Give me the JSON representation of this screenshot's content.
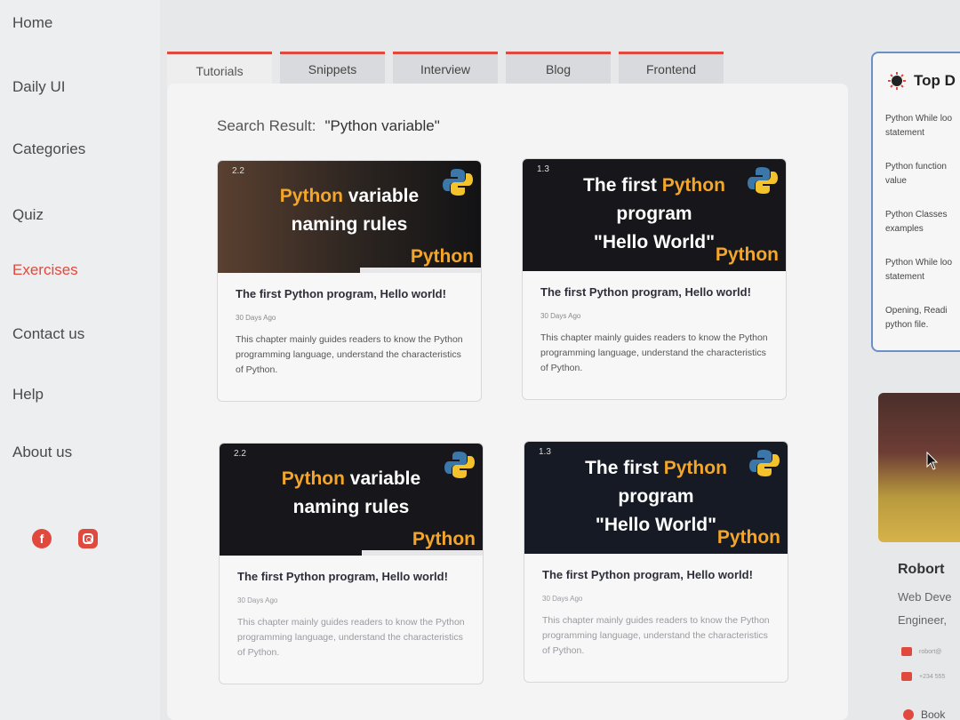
{
  "sidebar": {
    "items": [
      {
        "label": "Home"
      },
      {
        "label": "Daily UI"
      },
      {
        "label": "Categories"
      },
      {
        "label": "Quiz"
      },
      {
        "label": "Exercises"
      },
      {
        "label": "Contact us"
      },
      {
        "label": "Help"
      },
      {
        "label": "About us"
      }
    ],
    "active_index": 4
  },
  "tabs": [
    {
      "label": "Tutorials"
    },
    {
      "label": "Snippets"
    },
    {
      "label": "Interview"
    },
    {
      "label": "Blog"
    },
    {
      "label": "Frontend"
    }
  ],
  "search": {
    "label": "Search Result:",
    "query": "\"Python variable\""
  },
  "cards": [
    {
      "badge": "2.2",
      "thumb_line1_hl": "Python",
      "thumb_line1_rest": " variable",
      "thumb_line2": "naming rules",
      "thumb_python": "Python",
      "title": "The first Python program, Hello world!",
      "date": "30 Days Ago",
      "desc": "This chapter mainly guides readers to know the Python programming language, understand the characteristics of Python."
    },
    {
      "badge": "1.3",
      "thumb_line1_pre": "The first ",
      "thumb_line1_hl": "Python",
      "thumb_line2": "program",
      "thumb_line3": "\"Hello World\"",
      "thumb_python": "Python",
      "title": "The first Python program, Hello world!",
      "date": "30 Days Ago",
      "desc": "This chapter mainly guides readers to know the Python programming language, understand the characteristics of Python."
    },
    {
      "badge": "2.2",
      "thumb_line1_hl": "Python",
      "thumb_line1_rest": " variable",
      "thumb_line2": "naming rules",
      "thumb_python": "Python",
      "title": "The first Python program, Hello world!",
      "date": "30 Days Ago",
      "desc": "This chapter mainly guides readers to know the Python programming language, understand the characteristics of Python."
    },
    {
      "badge": "1.3",
      "thumb_line1_pre": "The first ",
      "thumb_line1_hl": "Python",
      "thumb_line2": "program",
      "thumb_line3": "\"Hello World\"",
      "thumb_python": "Python",
      "title": "The first Python program, Hello world!",
      "date": "30 Days Ago",
      "desc": "This chapter mainly guides readers to know the Python programming language, understand the characteristics of Python."
    }
  ],
  "top_panel": {
    "title": "Top D",
    "items": [
      {
        "line1": "Python While loo",
        "line2": "statement"
      },
      {
        "line1": "Python function",
        "line2": "value"
      },
      {
        "line1": "Python Classes",
        "line2": "examples"
      },
      {
        "line1": "Python While loo",
        "line2": "statement"
      },
      {
        "line1": "Opening, Readi",
        "line2": "python file."
      }
    ]
  },
  "profile": {
    "name": "Robort",
    "role_line1": "Web Deve",
    "role_line2": "Engineer,",
    "email": "robort@",
    "phone": "+234 555",
    "book_label": "Book"
  },
  "colors": {
    "accent": "#e0493e",
    "python_yellow": "#f4a62a",
    "python_blue": "#3b77a8"
  }
}
